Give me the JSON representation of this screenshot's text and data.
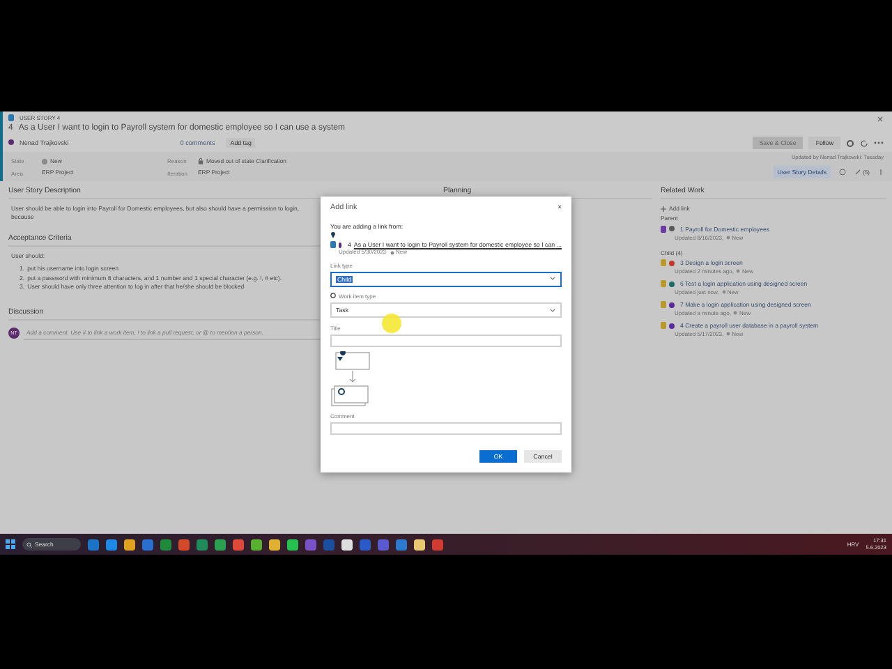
{
  "work_item": {
    "type_label": "USER STORY 4",
    "id": "4",
    "title": "As a User I want to login to Payroll system for domestic employee so I can use a system",
    "assignee": {
      "name": "Nenad Trajkovski",
      "color": "#5c2d6e"
    },
    "comments": "0 comments",
    "add_tag": "Add tag",
    "fields": [
      {
        "label": "State",
        "value": "New",
        "kind": "state"
      },
      {
        "label": "Reason",
        "value": "Moved out of state Clarification",
        "kind": "reason"
      },
      {
        "label": "Area",
        "value": "ERP Project",
        "kind": "plain"
      },
      {
        "label": "Iteration",
        "value": "ERP Project",
        "kind": "plain"
      }
    ],
    "save_button": {
      "label": "Save & Close",
      "disabled": true
    },
    "follow_button": "Follow",
    "updated": "Updated by Nenad Trajkovski: Tuesday",
    "tabs": [
      {
        "label": "User Story Details",
        "selected": true
      }
    ],
    "links_count": "(5)"
  },
  "description": {
    "heading": "User Story Description",
    "text": "User should be able to login into Payroll for Domestic employees, but also should have a permission to login, because"
  },
  "acceptance": {
    "heading": "Acceptance Criteria",
    "intro": "User should:",
    "items": [
      {
        "marker": "1.",
        "text": "put his username into login screen"
      },
      {
        "marker": "2.",
        "text": "put a password with minimum 8 characters, and 1 number and 1 special character (e.g. !, # etc)."
      },
      {
        "marker": "3.",
        "text": "User should have only three attention to log in after that he/she should be blocked"
      }
    ]
  },
  "discussion": {
    "heading": "Discussion",
    "avatar": "NT",
    "placeholder": "Add a comment. Use # to link a work item, ! to link a pull request, or @ to mention a person."
  },
  "planning": {
    "heading": "Planning"
  },
  "related_work": {
    "heading": "Related Work",
    "add_link": "Add link",
    "groups": [
      {
        "label": "Parent",
        "items": [
          {
            "title": "1 Payroll for Domestic employees",
            "updated": "Updated 8/16/2023,",
            "state": "New",
            "color": "#5a5a5a",
            "kind": "epic"
          }
        ]
      },
      {
        "label": "Child (4)",
        "items": [
          {
            "title": "3 Design a login screen",
            "updated": "Updated 2 minutes ago,",
            "state": "New",
            "color": "#c0392b",
            "kind": "task"
          },
          {
            "title": "6 Test a login application using designed screen",
            "updated": "Updated just now,",
            "state": "New",
            "color": "#1e6b6b",
            "kind": "task"
          },
          {
            "title": "7 Make a login application using designed screen",
            "updated": "Updated a minute ago,",
            "state": "New",
            "color": "#5b2a9e",
            "kind": "task"
          },
          {
            "title": "4 Create a payroll user database in a payroll system",
            "updated": "Updated 5/17/2023,",
            "state": "New",
            "color": "#5b2a9e",
            "kind": "task"
          }
        ]
      }
    ]
  },
  "dialog": {
    "title": "Add link",
    "close": "×",
    "intro": "You are adding a link from:",
    "item_id": "4",
    "item_title": "As a User I want to login to Payroll system for domestic employee so I can ...",
    "item_updated": "Updated 5/30/2023",
    "item_state": "New",
    "link_type": {
      "label": "Link type",
      "value": "Child",
      "highlighted": true
    },
    "work_item_type": {
      "label": "Work item type",
      "value": "Task"
    },
    "title_field": {
      "label": "Title"
    },
    "comment_field": {
      "label": "Comment"
    },
    "ok": "OK",
    "cancel": "Cancel"
  },
  "taskbar": {
    "search": "Search",
    "language": "HRV",
    "time": "17:31",
    "date": "5.6.2023"
  }
}
